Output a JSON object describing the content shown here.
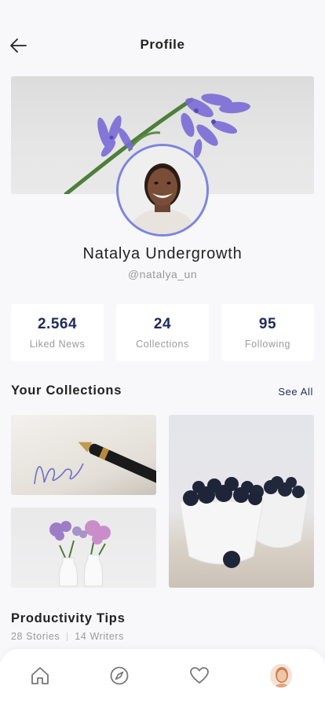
{
  "header": {
    "title": "Profile",
    "back_icon": "arrow-left-icon"
  },
  "profile": {
    "name": "Natalya Undergrowth",
    "handle": "@natalya_un"
  },
  "stats": [
    {
      "value": "2.564",
      "label": "Liked News"
    },
    {
      "value": "24",
      "label": "Collections"
    },
    {
      "value": "95",
      "label": "Following"
    }
  ],
  "collections": {
    "title": "Your Collections",
    "see_all": "See All"
  },
  "featured": {
    "title": "Productivity Tips",
    "stories": "28 Stories",
    "writers": "14 Writers"
  },
  "tabbar": {
    "icons": [
      "home-icon",
      "compass-icon",
      "heart-icon",
      "profile-avatar"
    ]
  },
  "colors": {
    "accent": "#1f2a5e",
    "avatar_ring": "#7c84e2",
    "muted_text": "#9a9a9a",
    "background": "#f8f8fa"
  }
}
